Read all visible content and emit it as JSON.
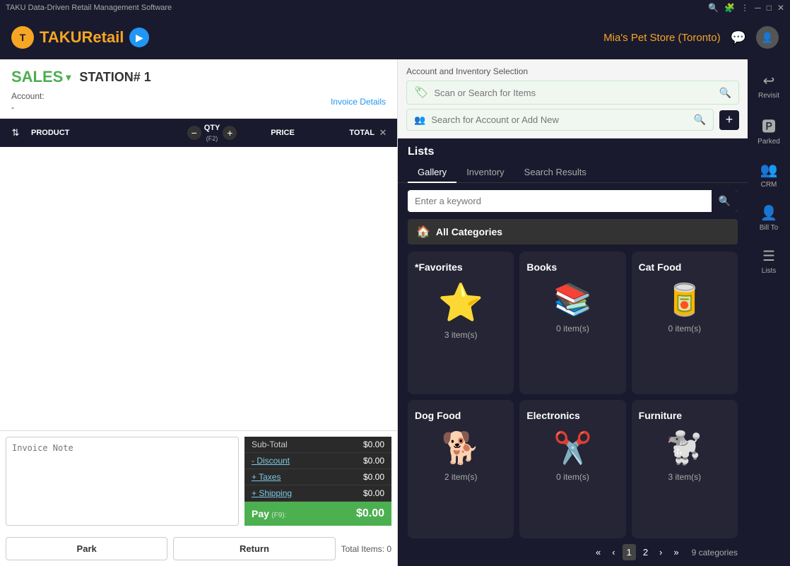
{
  "titleBar": {
    "appName": "TAKU Data-Driven Retail Management Software",
    "controls": [
      "minimize",
      "maximize",
      "close"
    ]
  },
  "topNav": {
    "logoText": "TAKU",
    "logoAccent": "Retail",
    "storeName": "Mia's Pet Store (Toronto)"
  },
  "salesPanel": {
    "title": "SALES",
    "station": "STATION# 1",
    "accountLabel": "Account:",
    "accountValue": "-",
    "invoiceDetailsBtn": "Invoice Details",
    "tableHeaders": {
      "product": "PRODUCT",
      "qty": "QTY",
      "qtyShortcut": "(F2)",
      "price": "PRICE",
      "total": "TOTAL"
    },
    "invoiceNotePlaceholder": "Invoice Note",
    "totals": {
      "subTotal": {
        "label": "Sub-Total",
        "value": "$0.00"
      },
      "discount": {
        "label": "- Discount",
        "value": "$0.00"
      },
      "taxes": {
        "label": "+ Taxes",
        "value": "$0.00"
      },
      "shipping": {
        "label": "+ Shipping",
        "value": "$0.00"
      },
      "pay": {
        "label": "Pay",
        "shortcut": "(F9):",
        "value": "$0.00"
      }
    },
    "totalItems": "Total Items: 0",
    "parkBtn": "Park",
    "returnBtn": "Return"
  },
  "rightPanel": {
    "searchSection": {
      "label": "Account and Inventory Selection",
      "itemSearchPlaceholder": "Scan or Search for Items",
      "accountSearchPlaceholder": "Search for Account or Add New"
    },
    "lists": {
      "title": "Lists",
      "tabs": [
        "Gallery",
        "Inventory",
        "Search Results"
      ],
      "activeTab": "Gallery",
      "keywordPlaceholder": "Enter a keyword",
      "allCategories": "All Categories",
      "categories": [
        {
          "name": "*Favorites",
          "icon": "⭐",
          "count": "3 item(s)"
        },
        {
          "name": "Books",
          "icon": "📚",
          "count": "0 item(s)"
        },
        {
          "name": "Cat Food",
          "icon": "🥫",
          "count": "0 item(s)"
        },
        {
          "name": "Dog Food",
          "icon": "🐕",
          "count": "2 item(s)"
        },
        {
          "name": "Electronics",
          "icon": "✂️",
          "count": "0 item(s)"
        },
        {
          "name": "Furniture",
          "icon": "🐩",
          "count": "3 item(s)"
        }
      ],
      "pagination": {
        "currentPage": 1,
        "totalPages": 2,
        "totalCategories": "9 categories"
      }
    }
  },
  "rightSidebar": {
    "items": [
      {
        "label": "Revisit",
        "icon": "↩"
      },
      {
        "label": "Parked",
        "icon": "🅿"
      },
      {
        "label": "CRM",
        "icon": "👥"
      },
      {
        "label": "Bill To",
        "icon": "👤"
      },
      {
        "label": "Lists",
        "icon": "☰"
      }
    ]
  }
}
